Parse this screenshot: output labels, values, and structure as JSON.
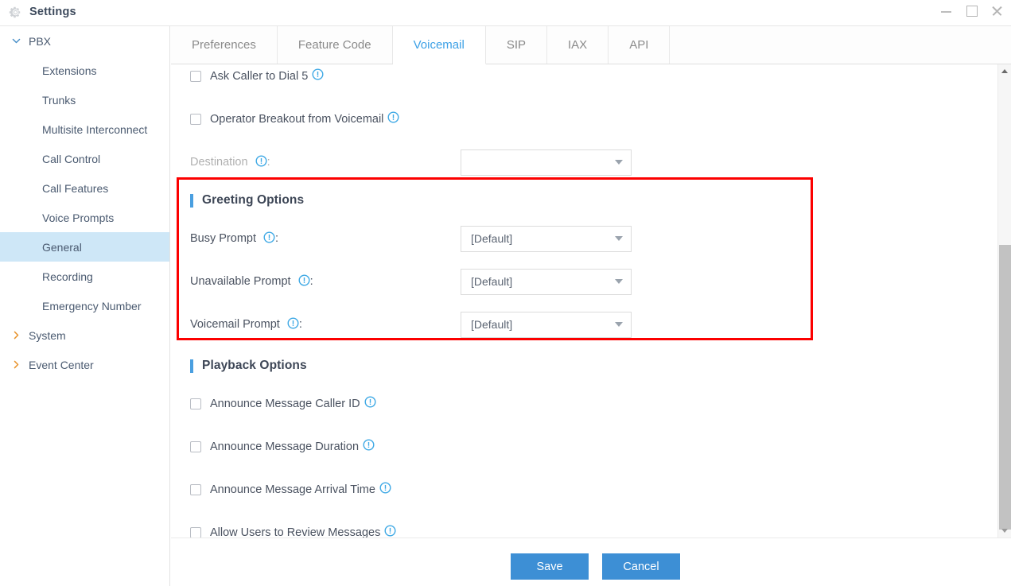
{
  "window": {
    "title": "Settings",
    "icon": "gear-icon",
    "controls": {
      "minimize": "—",
      "maximize": "□",
      "close": "✕"
    }
  },
  "sidebar": {
    "items": [
      {
        "label": "PBX",
        "level": "group",
        "expanded": true,
        "chevron": "chevron-down-icon",
        "selected": false
      },
      {
        "label": "Extensions",
        "level": "child",
        "selected": false
      },
      {
        "label": "Trunks",
        "level": "child",
        "selected": false
      },
      {
        "label": "Multisite Interconnect",
        "level": "child",
        "selected": false
      },
      {
        "label": "Call Control",
        "level": "child",
        "selected": false
      },
      {
        "label": "Call Features",
        "level": "child",
        "selected": false
      },
      {
        "label": "Voice Prompts",
        "level": "child",
        "selected": false
      },
      {
        "label": "General",
        "level": "child",
        "selected": true
      },
      {
        "label": "Recording",
        "level": "child",
        "selected": false
      },
      {
        "label": "Emergency Number",
        "level": "child",
        "selected": false
      },
      {
        "label": "System",
        "level": "group",
        "expanded": false,
        "chevron": "chevron-right-icon",
        "selected": false
      },
      {
        "label": "Event Center",
        "level": "group",
        "expanded": false,
        "chevron": "chevron-right-icon",
        "selected": false
      }
    ]
  },
  "tabs": {
    "items": [
      {
        "label": "Preferences",
        "active": false
      },
      {
        "label": "Feature Code",
        "active": false
      },
      {
        "label": "Voicemail",
        "active": true
      },
      {
        "label": "SIP",
        "active": false
      },
      {
        "label": "IAX",
        "active": false
      },
      {
        "label": "API",
        "active": false
      }
    ]
  },
  "content": {
    "clipped_row": {
      "label": "Ask Caller to Dial 5",
      "checked": false,
      "info": true
    },
    "operator_breakout": {
      "label": "Operator Breakout from Voicemail",
      "checked": false,
      "info": true
    },
    "destination": {
      "label": "Destination",
      "info": true,
      "value": "",
      "disabled": true
    },
    "greeting_options": {
      "title": "Greeting Options",
      "fields": [
        {
          "label": "Busy Prompt",
          "info": true,
          "value": "[Default]"
        },
        {
          "label": "Unavailable Prompt",
          "info": true,
          "value": "[Default]"
        },
        {
          "label": "Voicemail Prompt",
          "info": true,
          "value": "[Default]"
        }
      ]
    },
    "playback_options": {
      "title": "Playback Options",
      "checkboxes": [
        {
          "label": "Announce Message Caller ID",
          "checked": false,
          "info": true
        },
        {
          "label": "Announce Message Duration",
          "checked": false,
          "info": true
        },
        {
          "label": "Announce Message Arrival Time",
          "checked": false,
          "info": true
        },
        {
          "label": "Allow Users to Review Messages",
          "checked": false,
          "info": true
        }
      ]
    }
  },
  "footer": {
    "save_label": "Save",
    "cancel_label": "Cancel"
  },
  "annotation": {
    "highlight_color": "#FC0000",
    "target_section": "Greeting Options"
  },
  "colors": {
    "accent": "#3BA0E6",
    "button": "#3D8FD5",
    "section_bar": "#4A9FE0",
    "selected_nav": "#CEE7F7",
    "info_icon": "#3FA9E5",
    "highlight": "#FC0000"
  }
}
